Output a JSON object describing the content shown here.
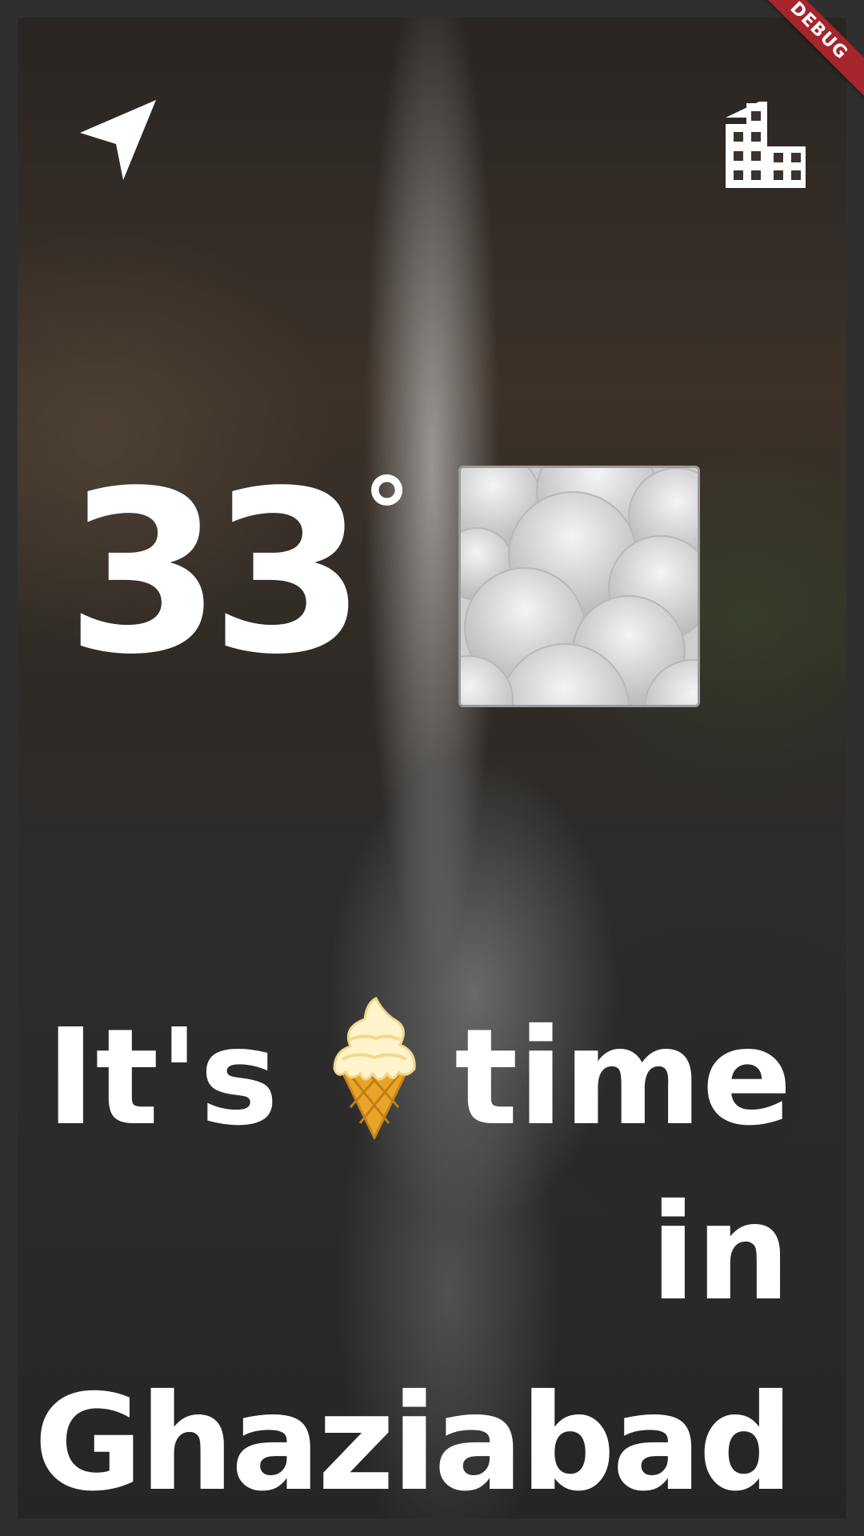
{
  "debug_banner": "DEBUG",
  "header": {
    "left_icon": "navigation-arrow-icon",
    "right_icon": "city-building-icon"
  },
  "weather": {
    "temperature": "33",
    "degree_symbol": "°",
    "condition_icon": "cloud-emoji-icon"
  },
  "message": {
    "word1": "It's",
    "emoji": "ice-cream-icon",
    "word2": "time",
    "word3": "in",
    "city": "Ghaziabad"
  },
  "colors": {
    "text": "#ffffff",
    "debug_ribbon": "#a4262c",
    "background": "#2f2f30"
  }
}
